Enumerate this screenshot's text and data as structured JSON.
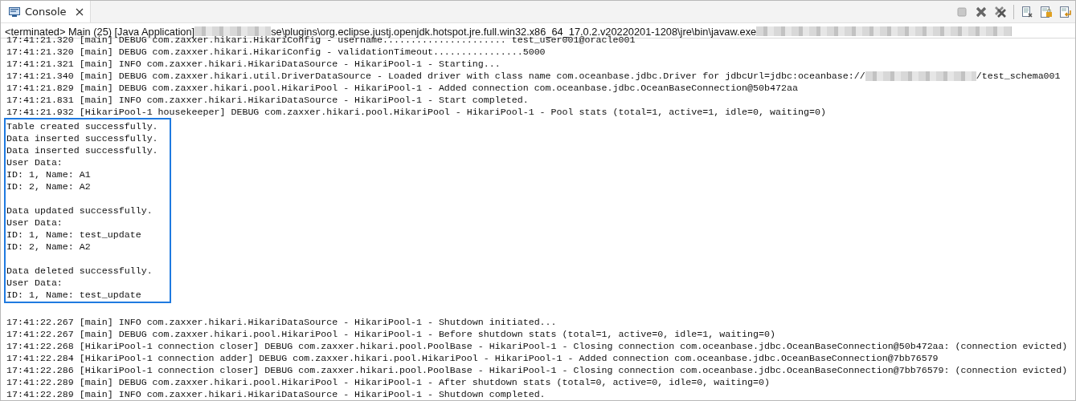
{
  "tab": {
    "label": "Console",
    "selected": true
  },
  "toolbar": [
    {
      "kind": "terminate",
      "disabled": true
    },
    {
      "kind": "remove",
      "disabled": false
    },
    {
      "kind": "remove-all",
      "disabled": false
    },
    {
      "kind": "separator"
    },
    {
      "kind": "clear",
      "disabled": false
    },
    {
      "kind": "scroll-lock",
      "disabled": false
    },
    {
      "kind": "word-wrap",
      "disabled": false
    }
  ],
  "header": [
    {
      "kind": "text",
      "text": "<terminated> Main (25) [Java Application] "
    },
    {
      "kind": "redacted"
    },
    {
      "kind": "text",
      "text": "se\\plugins\\org.eclipse.justj.openjdk.hotspot.jre.full.win32.x86_64_17.0.2.v20220201-1208\\jre\\bin\\javaw.exe "
    },
    {
      "kind": "redacted"
    }
  ],
  "log_before": [
    {
      "segments": [
        {
          "kind": "text",
          "text": "17:41:21.320 [main] DEBUG com.zaxxer.hikari.HikariConfig - username...................... test_user001@oracle001"
        }
      ]
    },
    {
      "segments": [
        {
          "kind": "text",
          "text": "17:41:21.320 [main] DEBUG com.zaxxer.hikari.HikariConfig - validationTimeout................5000"
        }
      ]
    },
    {
      "segments": [
        {
          "kind": "text",
          "text": "17:41:21.321 [main] INFO com.zaxxer.hikari.HikariDataSource - HikariPool-1 - Starting..."
        }
      ]
    },
    {
      "segments": [
        {
          "kind": "text",
          "text": "17:41:21.340 [main] DEBUG com.zaxxer.hikari.util.DriverDataSource - Loaded driver with class name com.oceanbase.jdbc.Driver for jdbcUrl=jdbc:oceanbase://"
        },
        {
          "kind": "redacted"
        },
        {
          "kind": "text",
          "text": "/test_schema001"
        }
      ]
    },
    {
      "segments": [
        {
          "kind": "text",
          "text": "17:41:21.829 [main] DEBUG com.zaxxer.hikari.pool.HikariPool - HikariPool-1 - Added connection com.oceanbase.jdbc.OceanBaseConnection@50b472aa"
        }
      ]
    },
    {
      "segments": [
        {
          "kind": "text",
          "text": "17:41:21.831 [main] INFO com.zaxxer.hikari.HikariDataSource - HikariPool-1 - Start completed."
        }
      ]
    },
    {
      "segments": [
        {
          "kind": "text",
          "text": "17:41:21.932 [HikariPool-1 housekeeper] DEBUG com.zaxxer.hikari.pool.HikariPool - HikariPool-1 - Pool stats (total=1, active=1, idle=0, waiting=0)"
        }
      ]
    }
  ],
  "highlighted_output": [
    [
      "Table created successfully.",
      "Data inserted successfully.",
      "Data inserted successfully.",
      "User Data:",
      "ID: 1, Name: A1",
      "ID: 2, Name: A2"
    ],
    [
      "Data updated successfully.",
      "User Data:",
      "ID: 1, Name: test_update",
      "ID: 2, Name: A2"
    ],
    [
      "Data deleted successfully.",
      "User Data:",
      "ID: 1, Name: test_update"
    ]
  ],
  "log_after": [
    "17:41:22.267 [main] INFO com.zaxxer.hikari.HikariDataSource - HikariPool-1 - Shutdown initiated...",
    "17:41:22.267 [main] DEBUG com.zaxxer.hikari.pool.HikariPool - HikariPool-1 - Before shutdown stats (total=1, active=0, idle=1, waiting=0)",
    "17:41:22.268 [HikariPool-1 connection closer] DEBUG com.zaxxer.hikari.pool.PoolBase - HikariPool-1 - Closing connection com.oceanbase.jdbc.OceanBaseConnection@50b472aa: (connection evicted)",
    "17:41:22.284 [HikariPool-1 connection adder] DEBUG com.zaxxer.hikari.pool.HikariPool - HikariPool-1 - Added connection com.oceanbase.jdbc.OceanBaseConnection@7bb76579",
    "17:41:22.286 [HikariPool-1 connection closer] DEBUG com.zaxxer.hikari.pool.PoolBase - HikariPool-1 - Closing connection com.oceanbase.jdbc.OceanBaseConnection@7bb76579: (connection evicted)",
    "17:41:22.289 [main] DEBUG com.zaxxer.hikari.pool.HikariPool - HikariPool-1 - After shutdown stats (total=0, active=0, idle=0, waiting=0)",
    "17:41:22.289 [main] INFO com.zaxxer.hikari.HikariDataSource - HikariPool-1 - Shutdown completed."
  ]
}
